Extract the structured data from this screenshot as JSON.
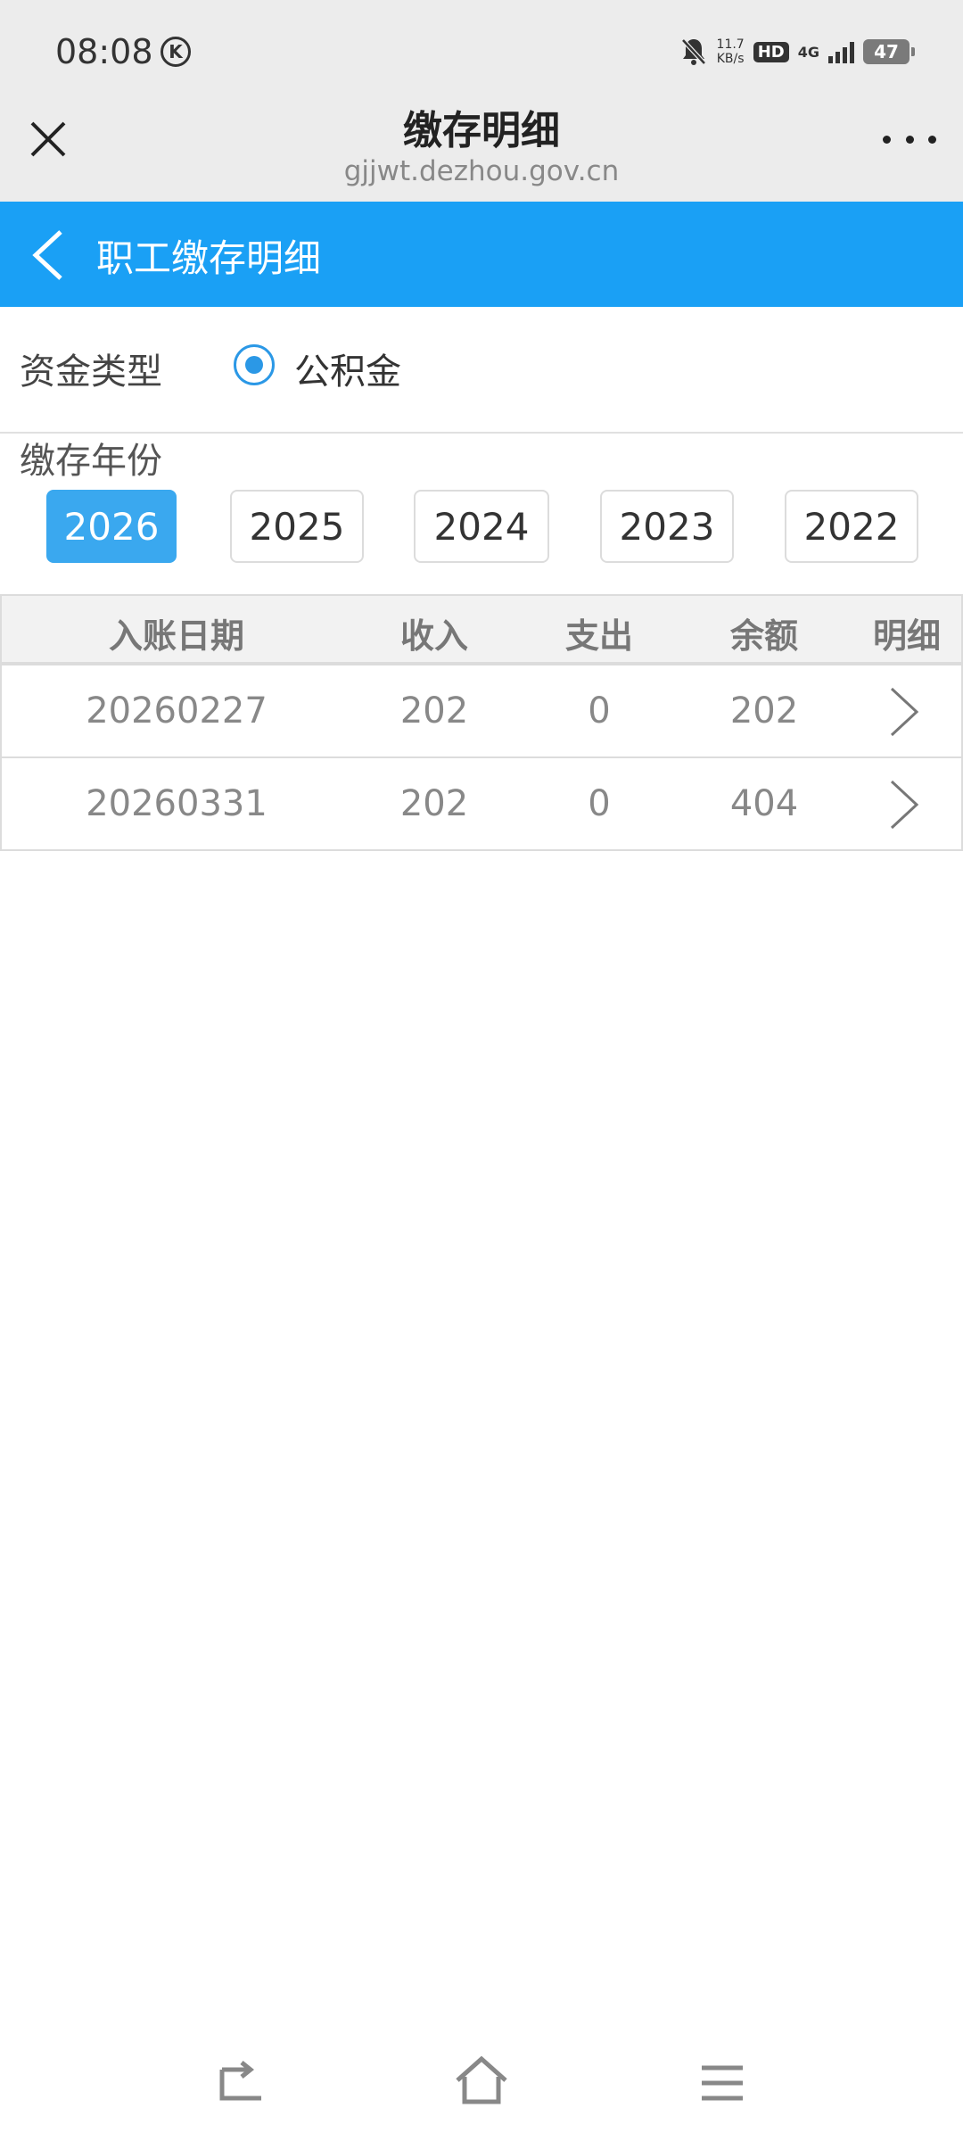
{
  "status_bar": {
    "time": "08:08",
    "k_badge": "K",
    "speed_value": "11.7",
    "speed_unit": "KB/s",
    "hd": "HD",
    "network": "4G",
    "battery": "47"
  },
  "browser": {
    "title": "缴存明细",
    "url": "gjjwt.dezhou.gov.cn"
  },
  "app_header": {
    "title": "职工缴存明细"
  },
  "fund_type": {
    "label": "资金类型",
    "option": "公积金",
    "selected": true
  },
  "years": {
    "label": "缴存年份",
    "options": [
      "2026",
      "2025",
      "2024",
      "2023",
      "2022"
    ],
    "selected": "2026"
  },
  "table": {
    "headers": [
      "入账日期",
      "收入",
      "支出",
      "余额",
      "明细"
    ],
    "rows": [
      {
        "date": "20260227",
        "income": "202",
        "expense": "0",
        "balance": "202"
      },
      {
        "date": "20260331",
        "income": "202",
        "expense": "0",
        "balance": "404"
      }
    ]
  },
  "colors": {
    "header_blue": "#1aa0f5",
    "active_year": "#3aa8ef",
    "radio": "#2b98e6"
  }
}
